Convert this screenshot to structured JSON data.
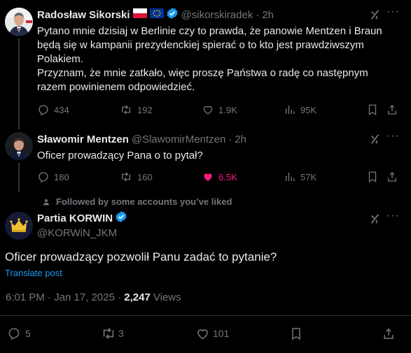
{
  "tweet1": {
    "author_name": "Radosław Sikorski",
    "handle": "@sikorskiradek",
    "time": "2h",
    "text_lines": [
      "Pytano mnie dzisiaj w Berlinie czy to prawda, że panowie Mentzen i Braun",
      "będą się w kampanii prezydenckiej spierać o to kto jest prawdziwszym",
      "Polakiem.",
      "Przyznam, że mnie zatkało, więc proszę Państwa o radę co następnym",
      "razem powinienem odpowiedzieć."
    ],
    "replies": "434",
    "reposts": "192",
    "likes": "1.9K",
    "views": "95K"
  },
  "tweet2": {
    "author_name": "Sławomir Mentzen",
    "handle": "@SlawomirMentzen",
    "time": "2h",
    "text": "Oficer prowadzący Pana o to pytał?",
    "replies": "180",
    "reposts": "160",
    "likes": "6.5K",
    "views": "57K"
  },
  "main_tweet": {
    "social_context": "Followed by some accounts you’ve liked",
    "author_name": "Partia KORWIN",
    "handle": "@KORWiN_JKM",
    "text": "Oficer prowadzący pozwolił Panu zadać to pytanie?",
    "translate": "Translate post",
    "timestamp": "6:01 PM · Jan 17, 2025 · ",
    "view_count": "2,247",
    "views_label": " Views",
    "replies": "5",
    "reposts": "3",
    "likes": "101"
  },
  "colors": {
    "background": "#000000",
    "text": "#e7e9ea",
    "secondary": "#71767b",
    "link": "#1d9bf0",
    "like": "#f91880",
    "verified": "#1d9bf0"
  },
  "icons": [
    "grok-icon",
    "more-icon",
    "reply-icon",
    "repost-icon",
    "like-icon",
    "views-icon",
    "bookmark-icon",
    "share-icon",
    "verified-icon",
    "person-icon",
    "poland-flag-icon",
    "eu-flag-icon"
  ]
}
